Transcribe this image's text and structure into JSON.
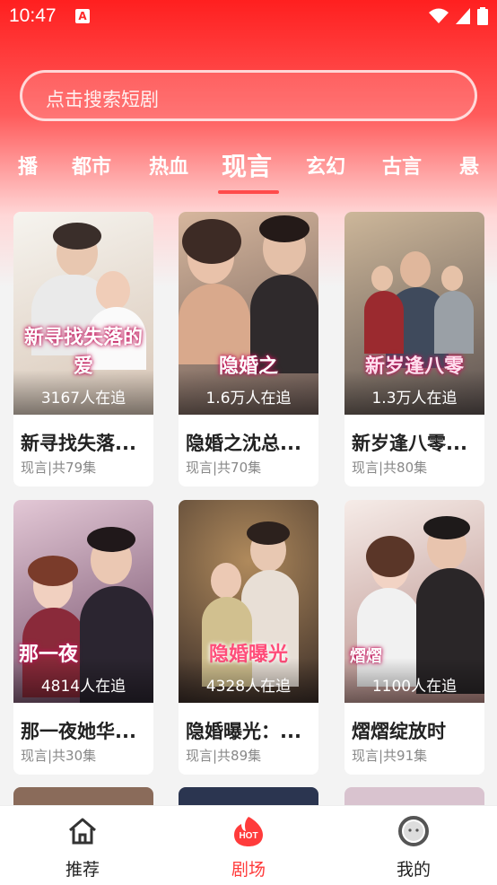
{
  "status_bar": {
    "time": "10:47",
    "notif_badge": "A"
  },
  "search": {
    "placeholder": "点击搜索短剧"
  },
  "tabs": [
    {
      "label": "播"
    },
    {
      "label": "都市"
    },
    {
      "label": "热血"
    },
    {
      "label": "现言",
      "active": true
    },
    {
      "label": "玄幻"
    },
    {
      "label": "古言"
    },
    {
      "label": "悬"
    }
  ],
  "cards": [
    {
      "title": "新寻找失落...",
      "meta": "现言|共79集",
      "followers": "3167人在追",
      "poster_text": "新寻找失落的爱",
      "colors": [
        "#f1efe9",
        "#d9c9b9"
      ]
    },
    {
      "title": "隐婚之沈总...",
      "meta": "现言|共70集",
      "followers": "1.6万人在追",
      "poster_text": "隐婚之",
      "colors": [
        "#caa48a",
        "#6f5d57"
      ]
    },
    {
      "title": "新岁逢八零...",
      "meta": "现言|共80集",
      "followers": "1.3万人在追",
      "poster_text": "新岁逢八零",
      "colors": [
        "#c9b495",
        "#5f5350"
      ]
    },
    {
      "title": "那一夜她华...",
      "meta": "现言|共30集",
      "followers": "4814人在追",
      "poster_text": "那一夜",
      "colors": [
        "#d8b7c8",
        "#6f4a66"
      ]
    },
    {
      "title": "隐婚曝光：...",
      "meta": "现言|共89集",
      "followers": "4328人在追",
      "poster_text": "隐婚曝光",
      "colors": [
        "#8a6a4f",
        "#3b2f2b"
      ]
    },
    {
      "title": "熠熠绽放时",
      "meta": "现言|共91集",
      "followers": "1100人在追",
      "poster_text": "熠熠",
      "colors": [
        "#f4e7e2",
        "#a97b76"
      ]
    }
  ],
  "bottom_nav": [
    {
      "label": "推荐",
      "icon": "home-icon"
    },
    {
      "label": "剧场",
      "icon": "hot-icon",
      "active": true,
      "badge_text": "HOT"
    },
    {
      "label": "我的",
      "icon": "profile-icon"
    }
  ],
  "colors": {
    "accent": "#ff3b3b",
    "header_red": "#ff1f1f"
  }
}
